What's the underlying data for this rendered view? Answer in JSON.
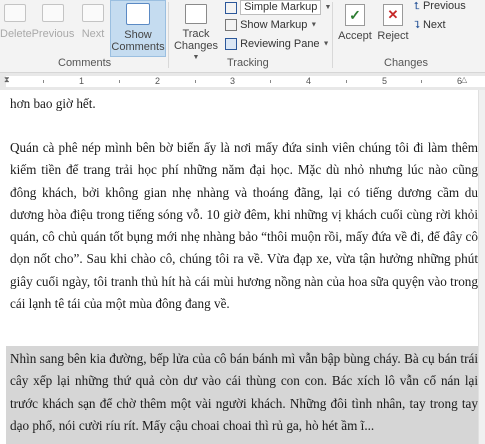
{
  "ribbon": {
    "comments": {
      "delete_label": "Delete",
      "previous_label": "Previous",
      "next_label": "Next",
      "show_comments_line1": "Show",
      "show_comments_line2": "Comments",
      "group_label": "Comments"
    },
    "tracking": {
      "track_changes_line1": "Track",
      "track_changes_line2": "Changes",
      "markup_select": "Simple Markup",
      "show_markup": "Show Markup",
      "reviewing_pane": "Reviewing Pane",
      "group_label": "Tracking"
    },
    "changes": {
      "accept_label": "Accept",
      "reject_label": "Reject",
      "previous_label": "Previous",
      "next_label": "Next",
      "group_label": "Changes"
    }
  },
  "ruler": {
    "numbers": [
      "1",
      "2",
      "3",
      "4",
      "5",
      "6"
    ]
  },
  "document": {
    "paragraphs": [
      "hơn bao giờ hết.",
      "Quán cà phê nép mình bên bờ biển ấy là nơi mấy đứa sinh viên chúng tôi đi làm thêm kiếm tiền để trang trải học phí những năm đại học. Mặc dù nhỏ nhưng lúc nào cũng đông khách, bởi không gian nhẹ nhàng và thoáng đãng, lại có tiếng dương cầm du dương hòa điệu trong tiếng sóng vỗ. 10 giờ đêm, khi những vị khách cuối cùng rời khỏi quán, cô chủ quán tốt bụng mới nhẹ nhàng bảo “thôi muộn rồi, mấy đứa về đi, để đây cô dọn nốt cho”. Sau khi chào cô, chúng tôi ra về. Vừa đạp xe, vừa tận hưởng những phút giây cuối ngày, tôi tranh thủ hít hà cái mùi hương nồng nàn của hoa sữa quyện vào trong cái lạnh tê tái của một mùa đông đang về.",
      "Nhìn sang bên kia đường, bếp lửa của cô bán bánh mì vẫn bập bùng cháy. Bà cụ bán trái cây xếp lại những thứ quả còn dư vào cái thùng con con. Bác xích lô vẫn cố nán lại trước khách sạn để chờ thêm một vài người khách. Những đôi tình nhân, tay trong tay dạo phố, nói cười ríu rít. Mấy cậu choai choai thì rủ ga, hò hét ầm ĩ..."
    ]
  },
  "colors": {
    "accent": "#2b579a",
    "highlight": "#d6d6d6",
    "accept_green": "#2e7d32",
    "reject_red": "#c62828"
  },
  "icons": [
    "delete-comment-icon",
    "previous-comment-icon",
    "next-comment-icon",
    "show-comments-icon",
    "track-changes-icon",
    "simple-markup-icon",
    "show-markup-icon",
    "reviewing-pane-icon",
    "accept-icon",
    "reject-icon",
    "previous-change-icon",
    "next-change-icon"
  ]
}
